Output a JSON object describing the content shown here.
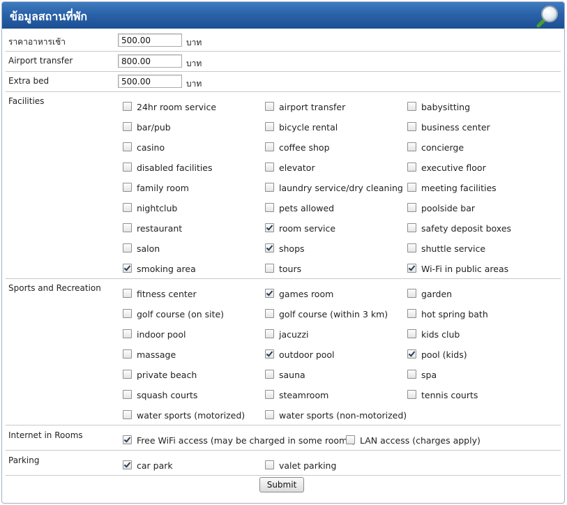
{
  "header": {
    "title": "ข้อมูลสถานที่พัก",
    "icon": "magnifier-icon"
  },
  "prices": [
    {
      "label": "ราคาอาหารเช้า",
      "value": "500.00",
      "unit": "บาท"
    },
    {
      "label": "Airport transfer",
      "value": "800.00",
      "unit": "บาท"
    },
    {
      "label": "Extra bed",
      "value": "500.00",
      "unit": "บาท"
    }
  ],
  "facilities": {
    "label": "Facilities",
    "options": [
      {
        "text": "24hr room service",
        "checked": false
      },
      {
        "text": "airport transfer",
        "checked": false
      },
      {
        "text": "babysitting",
        "checked": false
      },
      {
        "text": "bar/pub",
        "checked": false
      },
      {
        "text": "bicycle rental",
        "checked": false
      },
      {
        "text": "business center",
        "checked": false
      },
      {
        "text": "casino",
        "checked": false
      },
      {
        "text": "coffee shop",
        "checked": false
      },
      {
        "text": "concierge",
        "checked": false
      },
      {
        "text": "disabled facilities",
        "checked": false
      },
      {
        "text": "elevator",
        "checked": false
      },
      {
        "text": "executive floor",
        "checked": false
      },
      {
        "text": "family room",
        "checked": false
      },
      {
        "text": "laundry service/dry cleaning",
        "checked": false
      },
      {
        "text": "meeting facilities",
        "checked": false
      },
      {
        "text": "nightclub",
        "checked": false
      },
      {
        "text": "pets allowed",
        "checked": false
      },
      {
        "text": "poolside bar",
        "checked": false
      },
      {
        "text": "restaurant",
        "checked": false
      },
      {
        "text": "room service",
        "checked": true
      },
      {
        "text": "safety deposit boxes",
        "checked": false
      },
      {
        "text": "salon",
        "checked": false
      },
      {
        "text": "shops",
        "checked": true
      },
      {
        "text": "shuttle service",
        "checked": false
      },
      {
        "text": "smoking area",
        "checked": true
      },
      {
        "text": "tours",
        "checked": false
      },
      {
        "text": "Wi-Fi in public areas",
        "checked": true
      }
    ]
  },
  "sports": {
    "label": "Sports and Recreation",
    "options": [
      {
        "text": "fitness center",
        "checked": false
      },
      {
        "text": "games room",
        "checked": true
      },
      {
        "text": "garden",
        "checked": false
      },
      {
        "text": "golf course (on site)",
        "checked": false
      },
      {
        "text": "golf course (within 3 km)",
        "checked": false
      },
      {
        "text": "hot spring bath",
        "checked": false
      },
      {
        "text": "indoor pool",
        "checked": false
      },
      {
        "text": "jacuzzi",
        "checked": false
      },
      {
        "text": "kids club",
        "checked": false
      },
      {
        "text": "massage",
        "checked": false
      },
      {
        "text": "outdoor pool",
        "checked": true
      },
      {
        "text": "pool (kids)",
        "checked": true
      },
      {
        "text": "private beach",
        "checked": false
      },
      {
        "text": "sauna",
        "checked": false
      },
      {
        "text": "spa",
        "checked": false
      },
      {
        "text": "squash courts",
        "checked": false
      },
      {
        "text": "steamroom",
        "checked": false
      },
      {
        "text": "tennis courts",
        "checked": false
      },
      {
        "text": "water sports (motorized)",
        "checked": false
      },
      {
        "text": "water sports (non-motorized)",
        "checked": false
      }
    ]
  },
  "internet": {
    "label": "Internet in Rooms",
    "options": [
      {
        "text": "Free WiFi access (may be charged in some rooms)",
        "checked": true
      },
      {
        "text": "LAN access (charges apply)",
        "checked": false
      }
    ]
  },
  "parking": {
    "label": "Parking",
    "options": [
      {
        "text": "car park",
        "checked": true
      },
      {
        "text": "valet parking",
        "checked": false
      }
    ]
  },
  "submit_label": "Submit"
}
